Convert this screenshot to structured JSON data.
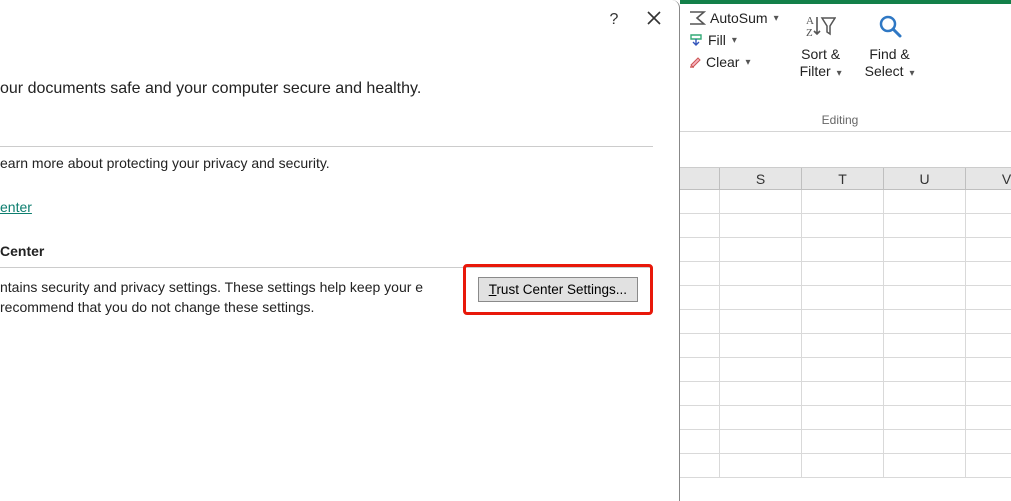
{
  "dialog": {
    "help_tooltip": "?",
    "intro": "our documents safe and your computer secure and healthy.",
    "privacy_para": "earn more about protecting your privacy and security.",
    "link": "enter",
    "section_heading": "Center",
    "settings_para": "ntains security and privacy settings. These settings help keep your e recommend that you do not change these settings.",
    "button_prefix": "T",
    "button_rest": "rust Center Settings..."
  },
  "ribbon": {
    "autosum": "AutoSum",
    "fill": "Fill",
    "clear": "Clear",
    "sort_l1": "Sort &",
    "sort_l2": "Filter",
    "find_l1": "Find &",
    "find_l2": "Select",
    "group": "Editing"
  },
  "sheet": {
    "columns": [
      "",
      "S",
      "T",
      "U",
      "V"
    ]
  }
}
